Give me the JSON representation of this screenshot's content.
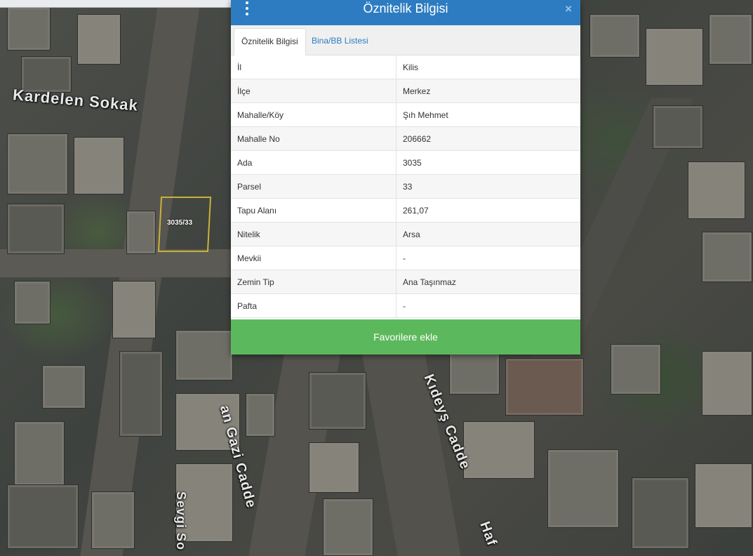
{
  "map": {
    "streets": [
      "Kardelen Sokak",
      "an Gazi Cadde",
      "Kıdeyş Cadde",
      "Sevgi So",
      "Haf"
    ],
    "parcel_label": "3035/33"
  },
  "panel": {
    "title": "Öznitelik Bilgisi",
    "close": "×",
    "tabs": [
      {
        "label": "Öznitelik Bilgisi",
        "active": true
      },
      {
        "label": "Bina/BB Listesi",
        "active": false
      }
    ],
    "rows": [
      {
        "key": "İl",
        "value": "Kilis"
      },
      {
        "key": "İlçe",
        "value": "Merkez"
      },
      {
        "key": "Mahalle/Köy",
        "value": "Şıh Mehmet"
      },
      {
        "key": "Mahalle No",
        "value": "206662"
      },
      {
        "key": "Ada",
        "value": "3035"
      },
      {
        "key": "Parsel",
        "value": "33"
      },
      {
        "key": "Tapu Alanı",
        "value": "261,07"
      },
      {
        "key": "Nitelik",
        "value": "Arsa"
      },
      {
        "key": "Mevkii",
        "value": "-"
      },
      {
        "key": "Zemin Tip",
        "value": "Ana Taşınmaz"
      },
      {
        "key": "Pafta",
        "value": "-"
      }
    ],
    "favorite_button": "Favorilere ekle"
  },
  "colors": {
    "header": "#2d7cc1",
    "button": "#5cb85c",
    "parcel": "#c9b23a"
  }
}
